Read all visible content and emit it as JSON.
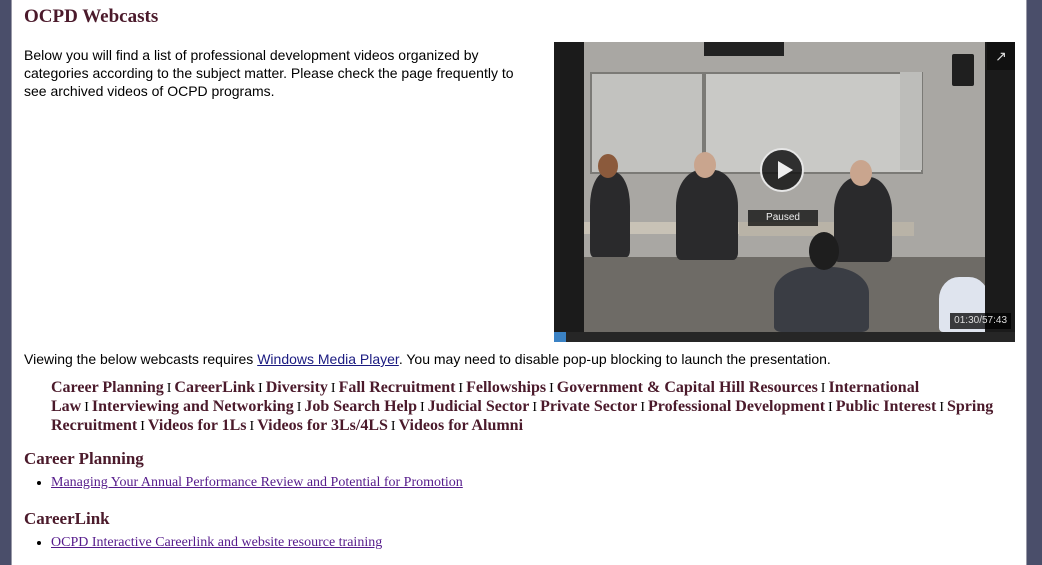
{
  "page": {
    "title": "OCPD Webcasts"
  },
  "intro": "Below you will find a list of professional development videos organized by categories according to the subject matter. Please check the page frequently to see archived videos of OCPD programs.",
  "video": {
    "status": "Paused",
    "time": "01:30/57:43",
    "progress": 0.026,
    "expand_icon": "external-link-icon",
    "play_icon": "play-icon"
  },
  "requirement": {
    "before": "Viewing the below webcasts requires ",
    "link": "Windows Media Player",
    "after": ". You may need to disable pop-up blocking to launch the presentation."
  },
  "categories": [
    "Career Planning",
    "CareerLink",
    "Diversity",
    "Fall Recruitment",
    "Fellowships",
    "Government & Capital Hill Resources",
    "International Law",
    "Interviewing and Networking",
    "Job Search Help",
    "Judicial Sector",
    "Private Sector",
    "Professional Development",
    "Public Interest",
    "Spring Recruitment",
    "Videos for 1Ls",
    "Videos for 3Ls/4LS",
    "Videos for Alumni"
  ],
  "category_separator": "I",
  "sections": [
    {
      "heading": "Career Planning",
      "items": [
        "Managing Your Annual Performance Review and Potential for Promotion"
      ]
    },
    {
      "heading": "CareerLink",
      "items": [
        "OCPD Interactive Careerlink and website resource training"
      ]
    }
  ],
  "colors": {
    "accent": "#4b1a2b",
    "link": "#551a8b",
    "progress": "#3b82c4"
  }
}
